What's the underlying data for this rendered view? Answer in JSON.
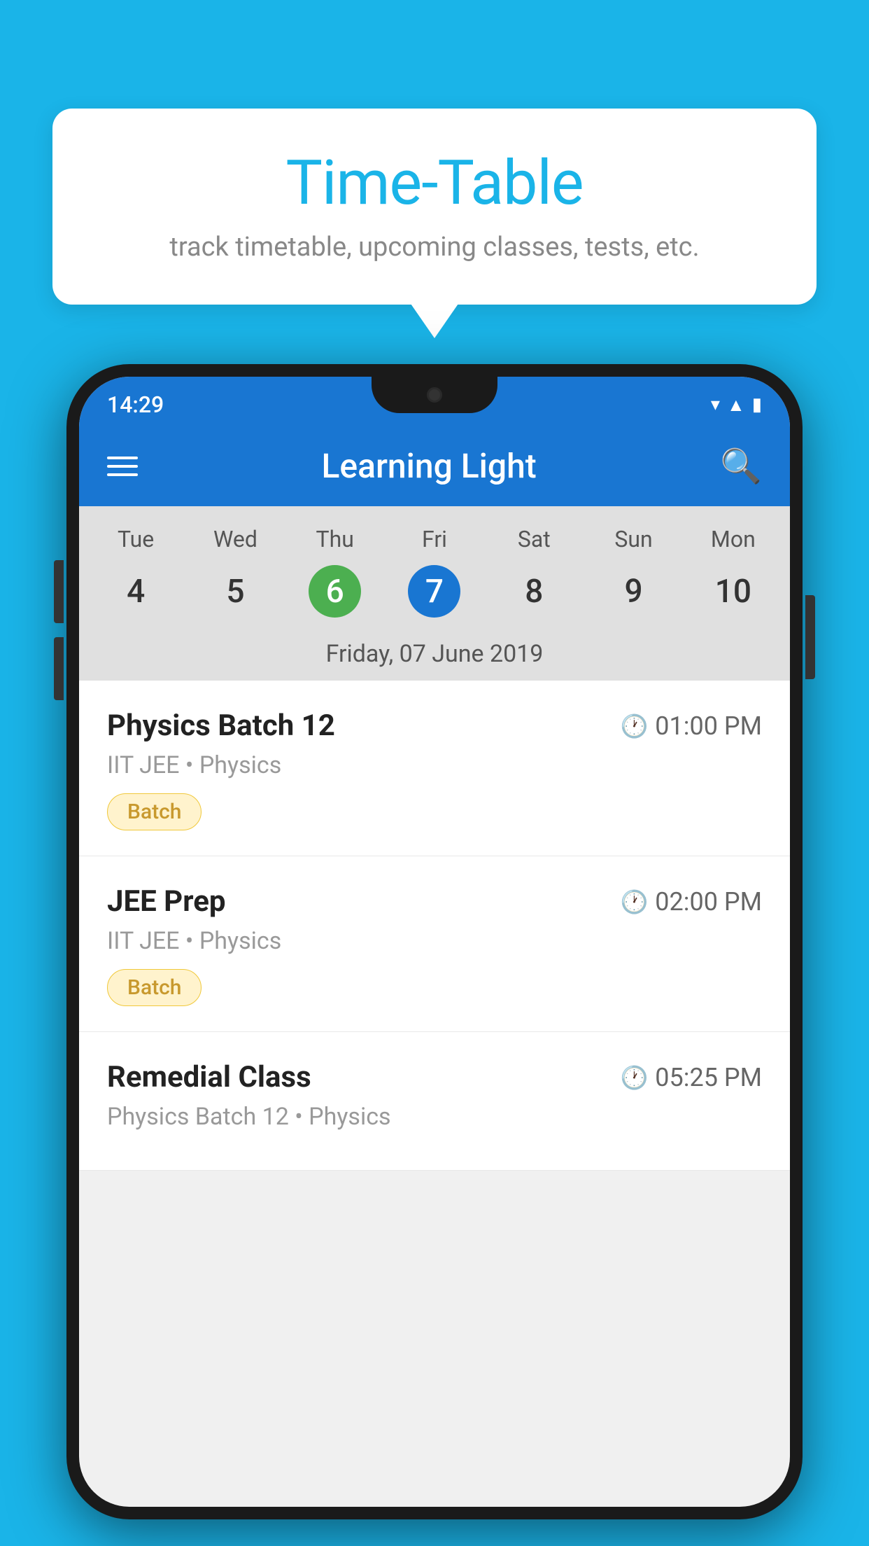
{
  "page": {
    "background_color": "#1ab4e8"
  },
  "speech_bubble": {
    "title": "Time-Table",
    "subtitle": "track timetable, upcoming classes, tests, etc."
  },
  "phone": {
    "status_bar": {
      "time": "14:29"
    },
    "app_bar": {
      "title": "Learning Light"
    },
    "calendar": {
      "days": [
        "Tue",
        "Wed",
        "Thu",
        "Fri",
        "Sat",
        "Sun",
        "Mon"
      ],
      "dates": [
        "4",
        "5",
        "6",
        "7",
        "8",
        "9",
        "10"
      ],
      "today_index": 2,
      "selected_index": 3,
      "selected_date_label": "Friday, 07 June 2019"
    },
    "schedule": [
      {
        "title": "Physics Batch 12",
        "time": "01:00 PM",
        "subtitle": "IIT JEE • Physics",
        "badge": "Batch"
      },
      {
        "title": "JEE Prep",
        "time": "02:00 PM",
        "subtitle": "IIT JEE • Physics",
        "badge": "Batch"
      },
      {
        "title": "Remedial Class",
        "time": "05:25 PM",
        "subtitle": "Physics Batch 12 • Physics",
        "badge": ""
      }
    ]
  }
}
